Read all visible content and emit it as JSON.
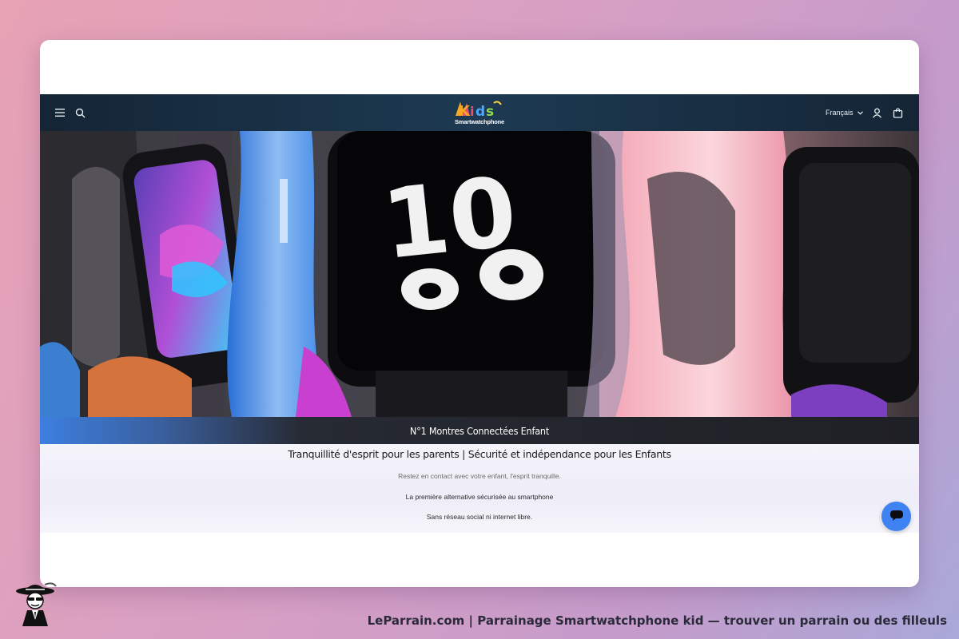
{
  "header": {
    "language": "Français",
    "logo_text": "Kids",
    "logo_tagline": "Smartwatchphone"
  },
  "icons": {
    "menu": "hamburger-menu-icon",
    "search": "search-icon",
    "language_chevron": "chevron-down-icon",
    "account": "user-icon",
    "cart": "shopping-bag-icon",
    "chat": "chat-bubble-icon"
  },
  "banner": {
    "text": "N°1 Montres Connectées Enfant"
  },
  "intro": {
    "title": "Tranquillité d'esprit pour les parents | Sécurité et indépendance pour les Enfants",
    "line1": "Restez en contact avec votre enfant, l'esprit tranquille.",
    "line2": "La première alternative sécurisée au smartphone",
    "line3": "Sans réseau social ni internet libre."
  },
  "footer": {
    "caption": "LeParrain.com | Parrainage Smartwatchphone kid — trouver un parrain ou des filleuls"
  },
  "colors": {
    "header_bg": "#1b3247",
    "banner_accent": "#3d7fe0",
    "chat_button": "#3f82f1",
    "page_bg_start": "#e8a3b4",
    "page_bg_end": "#a9a9d9"
  }
}
